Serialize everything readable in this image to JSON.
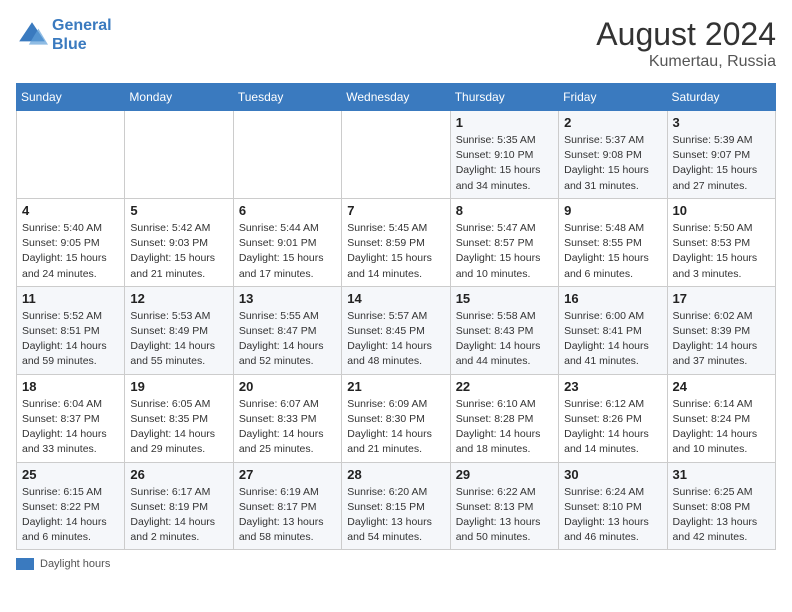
{
  "logo": {
    "line1": "General",
    "line2": "Blue"
  },
  "title": {
    "month_year": "August 2024",
    "location": "Kumertau, Russia"
  },
  "days_of_week": [
    "Sunday",
    "Monday",
    "Tuesday",
    "Wednesday",
    "Thursday",
    "Friday",
    "Saturday"
  ],
  "weeks": [
    [
      {
        "day": "",
        "info": ""
      },
      {
        "day": "",
        "info": ""
      },
      {
        "day": "",
        "info": ""
      },
      {
        "day": "",
        "info": ""
      },
      {
        "day": "1",
        "info": "Sunrise: 5:35 AM\nSunset: 9:10 PM\nDaylight: 15 hours\nand 34 minutes."
      },
      {
        "day": "2",
        "info": "Sunrise: 5:37 AM\nSunset: 9:08 PM\nDaylight: 15 hours\nand 31 minutes."
      },
      {
        "day": "3",
        "info": "Sunrise: 5:39 AM\nSunset: 9:07 PM\nDaylight: 15 hours\nand 27 minutes."
      }
    ],
    [
      {
        "day": "4",
        "info": "Sunrise: 5:40 AM\nSunset: 9:05 PM\nDaylight: 15 hours\nand 24 minutes."
      },
      {
        "day": "5",
        "info": "Sunrise: 5:42 AM\nSunset: 9:03 PM\nDaylight: 15 hours\nand 21 minutes."
      },
      {
        "day": "6",
        "info": "Sunrise: 5:44 AM\nSunset: 9:01 PM\nDaylight: 15 hours\nand 17 minutes."
      },
      {
        "day": "7",
        "info": "Sunrise: 5:45 AM\nSunset: 8:59 PM\nDaylight: 15 hours\nand 14 minutes."
      },
      {
        "day": "8",
        "info": "Sunrise: 5:47 AM\nSunset: 8:57 PM\nDaylight: 15 hours\nand 10 minutes."
      },
      {
        "day": "9",
        "info": "Sunrise: 5:48 AM\nSunset: 8:55 PM\nDaylight: 15 hours\nand 6 minutes."
      },
      {
        "day": "10",
        "info": "Sunrise: 5:50 AM\nSunset: 8:53 PM\nDaylight: 15 hours\nand 3 minutes."
      }
    ],
    [
      {
        "day": "11",
        "info": "Sunrise: 5:52 AM\nSunset: 8:51 PM\nDaylight: 14 hours\nand 59 minutes."
      },
      {
        "day": "12",
        "info": "Sunrise: 5:53 AM\nSunset: 8:49 PM\nDaylight: 14 hours\nand 55 minutes."
      },
      {
        "day": "13",
        "info": "Sunrise: 5:55 AM\nSunset: 8:47 PM\nDaylight: 14 hours\nand 52 minutes."
      },
      {
        "day": "14",
        "info": "Sunrise: 5:57 AM\nSunset: 8:45 PM\nDaylight: 14 hours\nand 48 minutes."
      },
      {
        "day": "15",
        "info": "Sunrise: 5:58 AM\nSunset: 8:43 PM\nDaylight: 14 hours\nand 44 minutes."
      },
      {
        "day": "16",
        "info": "Sunrise: 6:00 AM\nSunset: 8:41 PM\nDaylight: 14 hours\nand 41 minutes."
      },
      {
        "day": "17",
        "info": "Sunrise: 6:02 AM\nSunset: 8:39 PM\nDaylight: 14 hours\nand 37 minutes."
      }
    ],
    [
      {
        "day": "18",
        "info": "Sunrise: 6:04 AM\nSunset: 8:37 PM\nDaylight: 14 hours\nand 33 minutes."
      },
      {
        "day": "19",
        "info": "Sunrise: 6:05 AM\nSunset: 8:35 PM\nDaylight: 14 hours\nand 29 minutes."
      },
      {
        "day": "20",
        "info": "Sunrise: 6:07 AM\nSunset: 8:33 PM\nDaylight: 14 hours\nand 25 minutes."
      },
      {
        "day": "21",
        "info": "Sunrise: 6:09 AM\nSunset: 8:30 PM\nDaylight: 14 hours\nand 21 minutes."
      },
      {
        "day": "22",
        "info": "Sunrise: 6:10 AM\nSunset: 8:28 PM\nDaylight: 14 hours\nand 18 minutes."
      },
      {
        "day": "23",
        "info": "Sunrise: 6:12 AM\nSunset: 8:26 PM\nDaylight: 14 hours\nand 14 minutes."
      },
      {
        "day": "24",
        "info": "Sunrise: 6:14 AM\nSunset: 8:24 PM\nDaylight: 14 hours\nand 10 minutes."
      }
    ],
    [
      {
        "day": "25",
        "info": "Sunrise: 6:15 AM\nSunset: 8:22 PM\nDaylight: 14 hours\nand 6 minutes."
      },
      {
        "day": "26",
        "info": "Sunrise: 6:17 AM\nSunset: 8:19 PM\nDaylight: 14 hours\nand 2 minutes."
      },
      {
        "day": "27",
        "info": "Sunrise: 6:19 AM\nSunset: 8:17 PM\nDaylight: 13 hours\nand 58 minutes."
      },
      {
        "day": "28",
        "info": "Sunrise: 6:20 AM\nSunset: 8:15 PM\nDaylight: 13 hours\nand 54 minutes."
      },
      {
        "day": "29",
        "info": "Sunrise: 6:22 AM\nSunset: 8:13 PM\nDaylight: 13 hours\nand 50 minutes."
      },
      {
        "day": "30",
        "info": "Sunrise: 6:24 AM\nSunset: 8:10 PM\nDaylight: 13 hours\nand 46 minutes."
      },
      {
        "day": "31",
        "info": "Sunrise: 6:25 AM\nSunset: 8:08 PM\nDaylight: 13 hours\nand 42 minutes."
      }
    ]
  ],
  "legend": {
    "daylight_label": "Daylight hours"
  }
}
